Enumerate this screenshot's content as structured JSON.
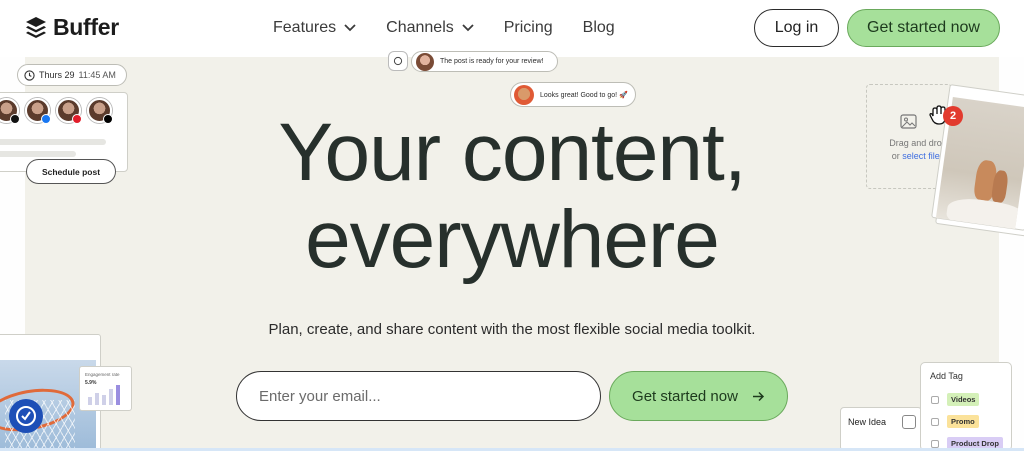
{
  "nav": {
    "logo_text": "Buffer",
    "links": [
      {
        "label": "Features",
        "has_dropdown": true
      },
      {
        "label": "Channels",
        "has_dropdown": true
      },
      {
        "label": "Pricing",
        "has_dropdown": false
      },
      {
        "label": "Blog",
        "has_dropdown": false
      }
    ],
    "login_label": "Log in",
    "cta_label": "Get started now"
  },
  "hero": {
    "headline_line1": "Your content,",
    "headline_line2": "everywhere",
    "subtitle": "Plan, create, and share content with the most flexible social media toolkit.",
    "email_placeholder": "Enter your email...",
    "cta_label": "Get started now",
    "cta_icon": "arrow-right-icon"
  },
  "floating": {
    "date_pill": "Thurs 29",
    "time_pill": "11:45 AM",
    "schedule_button": "Schedule post",
    "notification_1": "The post is ready for your review!",
    "notification_2": "Looks great! Good to go! 🚀",
    "drop_text": "Drag and drop",
    "drop_or": "or",
    "drop_link": "select files",
    "badge_count": "2",
    "engagement_label": "Engagement rate",
    "engagement_value": "5.9%",
    "new_idea": "New Idea",
    "add_tag_title": "Add Tag",
    "tags": [
      {
        "label": "Videos",
        "color": "#d4f0b8"
      },
      {
        "label": "Promo",
        "color": "#fbe29a"
      },
      {
        "label": "Product Drop",
        "color": "#d9cdf5"
      }
    ]
  },
  "colors": {
    "accent_green": "#a6e09a",
    "hero_bg": "#f2f1ea",
    "headline": "#27302c"
  }
}
